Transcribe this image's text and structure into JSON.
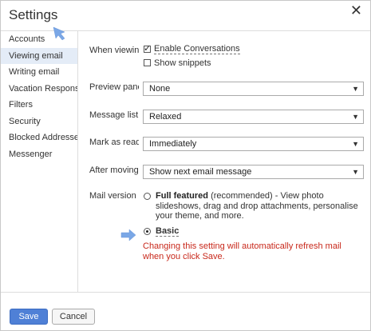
{
  "dialog": {
    "title": "Settings"
  },
  "sidebar": {
    "items": [
      {
        "label": "Accounts"
      },
      {
        "label": "Viewing email"
      },
      {
        "label": "Writing email"
      },
      {
        "label": "Vacation Response"
      },
      {
        "label": "Filters"
      },
      {
        "label": "Security"
      },
      {
        "label": "Blocked Addresses"
      },
      {
        "label": "Messenger"
      }
    ]
  },
  "settings": {
    "when_viewing": {
      "label": "When viewing",
      "enable_conversations": {
        "label": "Enable Conversations",
        "checked": true
      },
      "show_snippets": {
        "label": "Show snippets",
        "checked": false
      }
    },
    "preview_pane": {
      "label": "Preview pane",
      "value": "None"
    },
    "message_list": {
      "label": "Message list d",
      "value": "Relaxed"
    },
    "mark_as_read": {
      "label": "Mark as read",
      "value": "Immediately"
    },
    "after_moving": {
      "label": "After moving",
      "value": "Show next email message"
    },
    "mail_version": {
      "label": "Mail version",
      "full_featured": {
        "title": "Full featured",
        "desc": " (recommended) - View photo slideshows, drag and drop attachments, personalise your theme, and more.",
        "selected": false
      },
      "basic": {
        "title": "Basic",
        "selected": true
      },
      "warning": "Changing this setting will automatically refresh mail when you click Save."
    }
  },
  "buttons": {
    "save": "Save",
    "cancel": "Cancel"
  },
  "colors": {
    "accent": "#4f80d6",
    "warning": "#c8281b",
    "selected_bg": "#e4ecf7",
    "arrow": "#7aa7e6"
  },
  "icons": [
    "close-icon",
    "chevron-down-icon",
    "pointer-arrow-icon"
  ]
}
